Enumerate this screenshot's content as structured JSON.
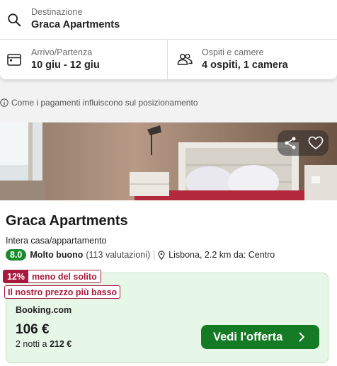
{
  "search": {
    "destination_label": "Destinazione",
    "destination_value": "Graca Apartments",
    "dates_label": "Arrivo/Partenza",
    "dates_value": "10 giu - 12 giu",
    "guests_label": "Ospiti e camere",
    "guests_value": "4 ospiti, 1 camera"
  },
  "info": {
    "text": "Come i pagamenti influiscono sul posizionamento",
    "icon": "info-icon"
  },
  "hotel": {
    "name": "Graca Apartments",
    "type": "Intera casa/appartamento",
    "rating_score": "8.0",
    "rating_word": "Molto buono",
    "rating_count": "(113 valutazioni)",
    "location": "Lisbona, 2.2 km da: Centro"
  },
  "deal": {
    "discount_pct": "12%",
    "discount_text": "meno del solito",
    "lowest_price_text": "Il nostro prezzo più basso",
    "provider": "Booking.com",
    "price": "106 €",
    "nights_text": "2 notti a",
    "total_price": "212 €",
    "cta_label": "Vedi l'offerta"
  },
  "colors": {
    "rating_green": "#1a8a2c",
    "cta_green": "#147a23",
    "deal_bg": "#e6f6e7",
    "tag_red": "#a8193d"
  },
  "icons": [
    "search-icon",
    "calendar-icon",
    "people-icon",
    "info-icon",
    "share-icon",
    "heart-icon",
    "location-pin-icon",
    "chevron-right-icon"
  ]
}
